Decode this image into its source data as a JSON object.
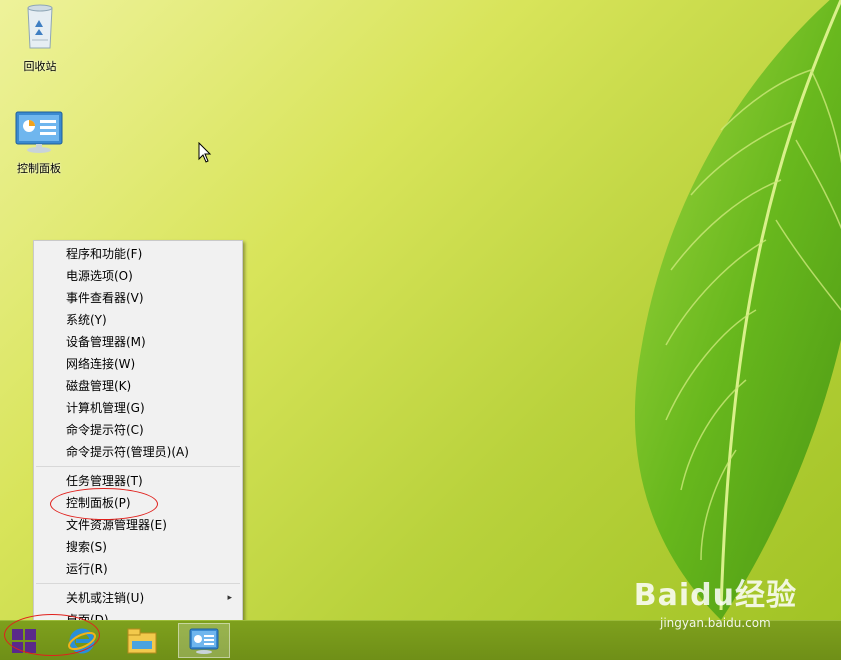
{
  "desktop": {
    "icons": [
      {
        "label": "回收站",
        "icon": "recycle-bin-icon"
      },
      {
        "label": "控制面板",
        "icon": "control-panel-icon"
      }
    ]
  },
  "context_menu": {
    "groups": [
      [
        "程序和功能(F)",
        "电源选项(O)",
        "事件查看器(V)",
        "系统(Y)",
        "设备管理器(M)",
        "网络连接(W)",
        "磁盘管理(K)",
        "计算机管理(G)",
        "命令提示符(C)",
        "命令提示符(管理员)(A)"
      ],
      [
        "任务管理器(T)",
        "控制面板(P)",
        "文件资源管理器(E)",
        "搜索(S)",
        "运行(R)"
      ],
      [
        "关机或注销(U)",
        "桌面(D)"
      ]
    ],
    "submenu_arrow": "▸"
  },
  "taskbar": {
    "items": [
      {
        "icon": "internet-explorer-icon"
      },
      {
        "icon": "file-explorer-icon"
      },
      {
        "icon": "control-panel-icon",
        "active": true
      }
    ]
  },
  "watermark": {
    "logo_text": "Baidu经验",
    "url": "jingyan.baidu.com"
  },
  "colors": {
    "annotation": "#e0201c",
    "taskbar": "#7ea01d",
    "menu_background": "#f1f1f1"
  }
}
